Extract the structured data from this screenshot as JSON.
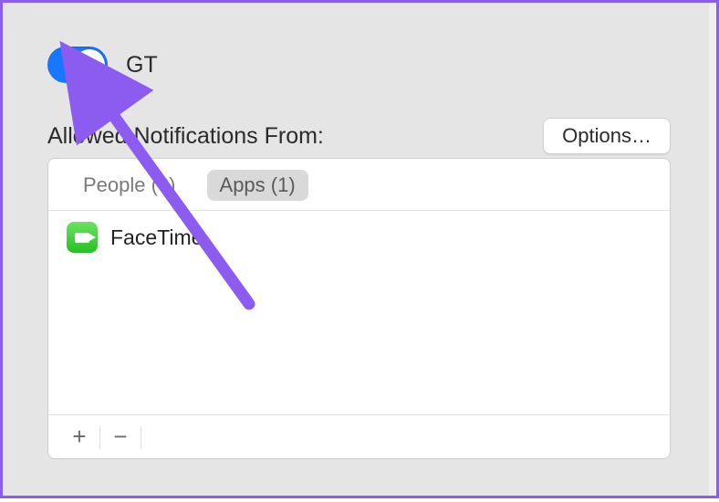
{
  "focusMode": {
    "name": "GT",
    "enabled": true
  },
  "section": {
    "title": "Allowed Notifications From:",
    "optionsLabel": "Options…"
  },
  "tabs": {
    "peopleLabel": "People (0)",
    "appsLabel": "Apps (1)"
  },
  "apps": [
    {
      "name": "FaceTime",
      "icon": "facetime-icon"
    }
  ],
  "footer": {
    "add": "+",
    "remove": "−"
  },
  "colors": {
    "accent": "#1778ff",
    "annotation": "#8c5cf0"
  }
}
